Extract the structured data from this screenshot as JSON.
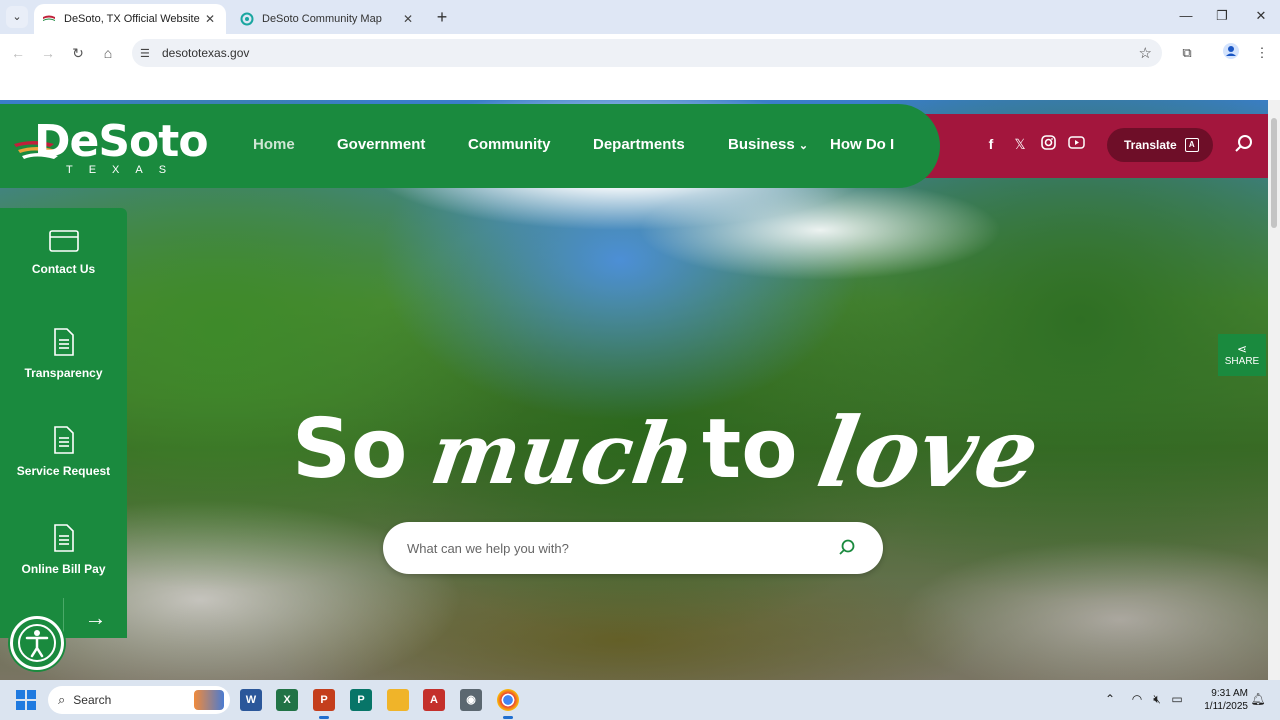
{
  "browser": {
    "tabs": [
      {
        "title": "DeSoto, TX Official Website",
        "active": true
      },
      {
        "title": "DeSoto Community Map",
        "active": false
      }
    ],
    "url": "desototexas.gov"
  },
  "site": {
    "logo_text": "DeSoto",
    "logo_sub": "TEXAS",
    "nav": [
      "Home",
      "Government",
      "Community",
      "Departments",
      "Business",
      "How Do I"
    ],
    "translate_label": "Translate",
    "social_icons": [
      "facebook-icon",
      "x-icon",
      "instagram-icon",
      "youtube-icon"
    ],
    "quick_links": [
      "Contact Us",
      "Transparency",
      "Service Request",
      "Online Bill Pay"
    ],
    "share_label": "SHARE",
    "tagline": {
      "so": "So",
      "much": "much",
      "to": "to",
      "love": "love"
    },
    "search_placeholder": "What can we help you with?"
  },
  "colors": {
    "brand_green": "#1a8a3e",
    "brand_red": "#a3163d"
  },
  "taskbar": {
    "search_label": "Search",
    "time": "9:31 AM",
    "date": "1/11/2025"
  }
}
